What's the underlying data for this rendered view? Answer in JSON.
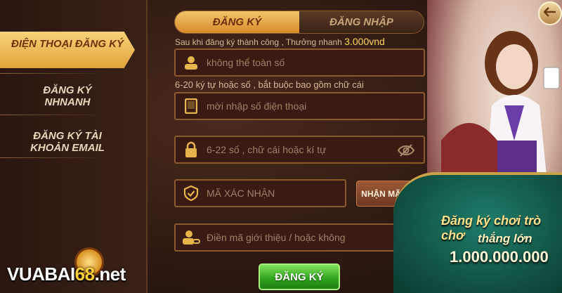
{
  "sidebar": {
    "items": [
      {
        "label": "ĐIỆN THOẠI ĐĂNG KÝ",
        "active": true
      },
      {
        "label": "ĐĂNG KÝ NHNANH",
        "active": false
      },
      {
        "label": "ĐĂNG KÝ TÀI KHOẢN EMAIL",
        "active": false
      }
    ]
  },
  "tabs": {
    "register": "ĐĂNG KÝ",
    "login": "ĐĂNG NHẬP"
  },
  "bonus_hint": {
    "text": "Sau khi đăng ký thành công , Thưởng nhanh",
    "amount": "3.000vnd"
  },
  "username": {
    "placeholder": "không thể toàn số",
    "hint": "6-20 ký tự hoặc số , bắt buộc bao gồm chữ cái"
  },
  "phone": {
    "placeholder": "mời nhập số điện thoại"
  },
  "password": {
    "placeholder": "6-22 số , chữ cái hoặc kí tự"
  },
  "otp": {
    "placeholder": "MÃ XÁC NHẬN",
    "button": "NHẬN MÃ OTP"
  },
  "referral": {
    "placeholder": "Điền mã giới thiệu / hoặc không"
  },
  "submit_label": "ĐĂNG KÝ",
  "promo": {
    "line1": "Đăng ký chơi trò chơ",
    "line2": "thắng lớn",
    "line3": "1.000.000.000"
  },
  "watermark": {
    "prefix": "VUABAI",
    "highlight": "68",
    "suffix": ".net"
  },
  "colors": {
    "accent": "#e3a33a",
    "submit": "#2fa21e",
    "amount": "#ffd35a"
  }
}
